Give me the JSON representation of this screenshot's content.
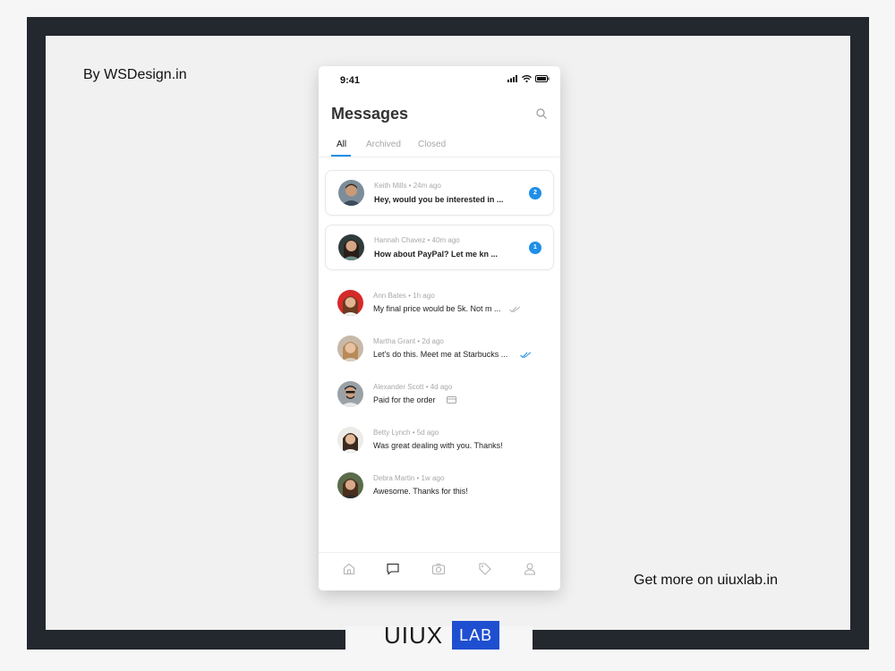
{
  "credits": {
    "by": "By WSDesign.in",
    "more": "Get more on uiuxlab.in",
    "brand_text": "UIUX",
    "brand_box": "LAB"
  },
  "phone": {
    "time": "9:41",
    "title": "Messages",
    "tabs": [
      {
        "label": "All",
        "active": true
      },
      {
        "label": "Archived",
        "active": false
      },
      {
        "label": "Closed",
        "active": false
      }
    ],
    "conversations": [
      {
        "name": "Keith Mills",
        "time": "24m ago",
        "preview": "Hey, would you be interested in ...",
        "unread": "2",
        "highlighted": true,
        "status_icon": "none"
      },
      {
        "name": "Hannah Chavez",
        "time": "40m ago",
        "preview": "How about PayPal? Let me kn ...",
        "unread": "1",
        "highlighted": true,
        "status_icon": "none"
      },
      {
        "name": "Ann Bates",
        "time": "1h ago",
        "preview": "My final price would be 5k. Not m ...",
        "status_icon": "double-check-grey-icon"
      },
      {
        "name": "Martha Grant",
        "time": "2d ago",
        "preview": "Let's do this. Meet me at Starbucks ...",
        "status_icon": "double-check-blue-icon"
      },
      {
        "name": "Alexander Scott",
        "time": "4d ago",
        "preview": "Paid for the order",
        "status_icon": "card-icon"
      },
      {
        "name": "Betty Lynch",
        "time": "5d ago",
        "preview": "Was great dealing with you. Thanks!",
        "status_icon": "none"
      },
      {
        "name": "Debra Martin",
        "time": "1w ago",
        "preview": "Awesome. Thanks for this!",
        "status_icon": "none"
      }
    ],
    "bottom_nav": [
      "home-icon",
      "chat-icon",
      "camera-icon",
      "tag-icon",
      "profile-icon"
    ],
    "colors": {
      "accent": "#1f8fe8",
      "brand": "#1f4fd1",
      "frame": "#23272e"
    }
  }
}
